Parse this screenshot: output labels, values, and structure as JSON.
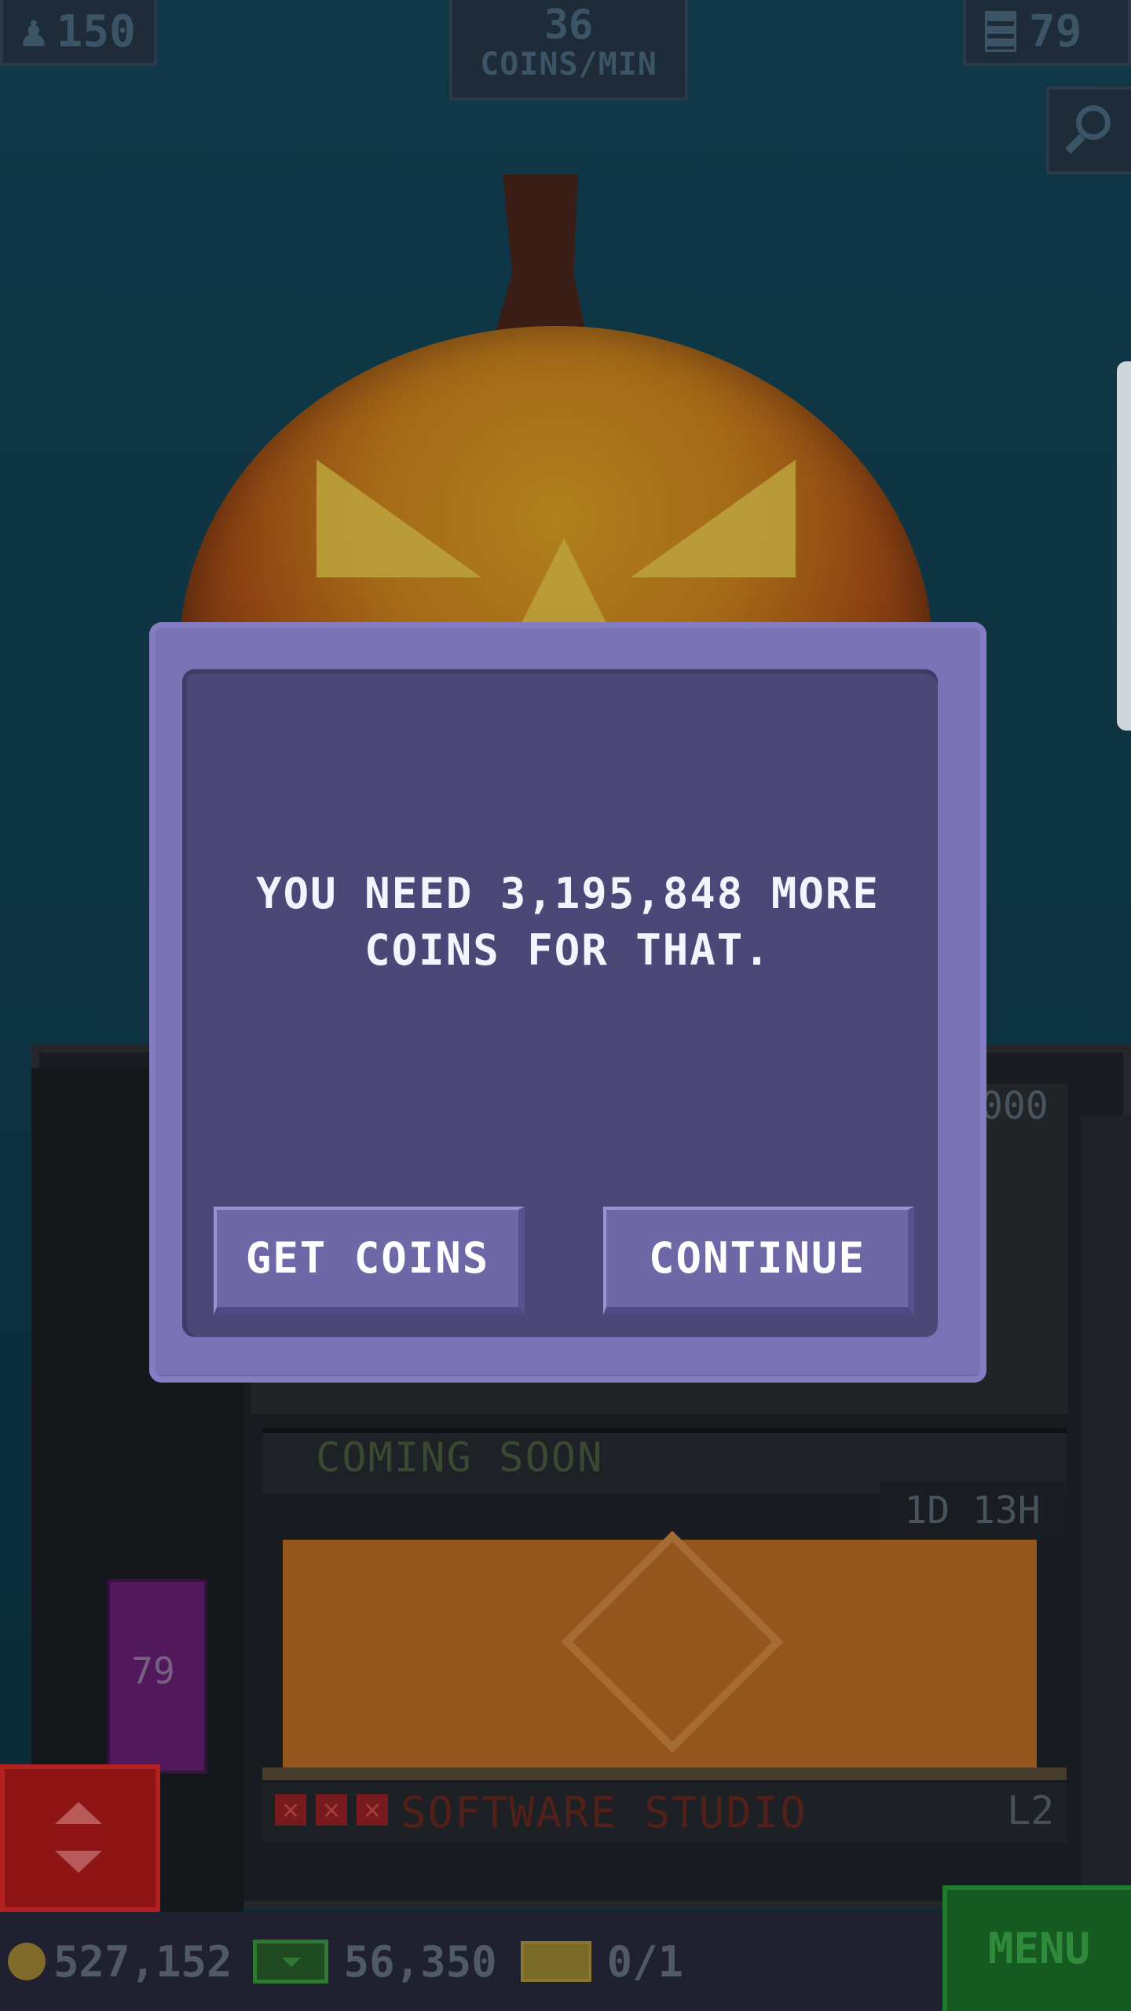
{
  "hud": {
    "population": "150",
    "coins_per_min_value": "36",
    "coins_per_min_unit": "COINS/MIN",
    "floors": "79"
  },
  "tower": {
    "top_floor_value": "000",
    "coming_soon_label": "COMING SOON",
    "timer": "1D 13H",
    "studio_label": "SOFTWARE STUDIO",
    "studio_level": "L2",
    "elevator_floor": "79"
  },
  "bottom_bar": {
    "coins": "527,152",
    "bux": "56,350",
    "tickets": "0/1",
    "menu_label": "MENU"
  },
  "dialog": {
    "message_line1": "YOU NEED 3,195,848 MORE",
    "message_line2": "COINS FOR THAT.",
    "get_coins_label": "GET COINS",
    "continue_label": "CONTINUE"
  },
  "colors": {
    "sky": "#0f3c4b",
    "dialog_frame": "#7b72b5",
    "dialog_body": "#4b4877",
    "button": "#6f68a7",
    "menu_green": "#155a20"
  }
}
